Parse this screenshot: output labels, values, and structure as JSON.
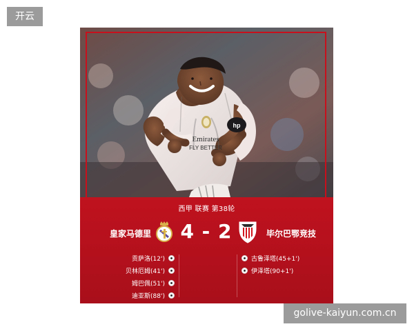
{
  "brand_label": "开云",
  "url_label": "golive-kaiyun.com.cn",
  "match": {
    "competition": "西甲 联赛 第38轮",
    "home_team": "皇家马德里",
    "away_team": "毕尔巴鄂竞技",
    "score": "4 - 2",
    "home_scorers": [
      "贡萨洛(12')",
      "贝林厄姆(41')",
      "姆巴佩(51')",
      "迪亚斯(88')"
    ],
    "away_scorers": [
      "古鲁泽塔(45+1')",
      "伊泽塔(90+1')"
    ]
  },
  "photo": {
    "jersey_sponsor_text": "Emirates\nFLY BETTER",
    "description_visible_text": ""
  },
  "colors": {
    "primary_red": "#c0121f",
    "dark_red": "#a80f1a",
    "badge_gray": "#9b9b9b",
    "white": "#ffffff"
  },
  "icons": {
    "home_crest": "real-madrid-crest-icon",
    "away_crest": "athletic-club-crest-icon",
    "goal_ball": "soccer-ball-icon"
  }
}
